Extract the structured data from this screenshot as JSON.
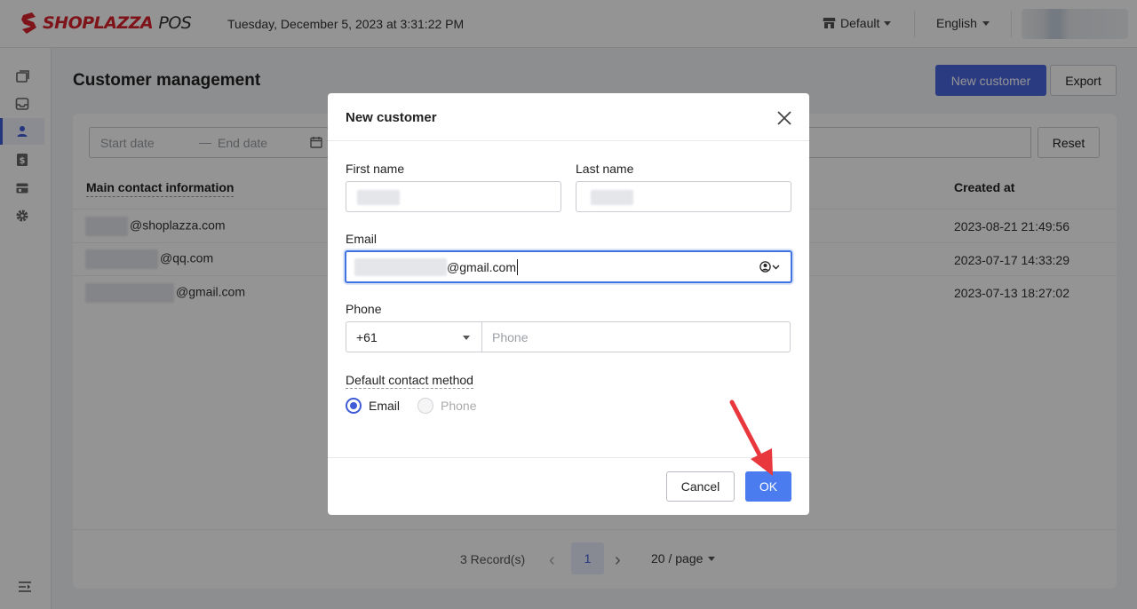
{
  "header": {
    "logo_text": "SHOPLAZZA",
    "logo_suffix": "POS",
    "datetime": "Tuesday, December 5, 2023 at 3:31:22 PM",
    "store": "Default",
    "language": "English"
  },
  "sidebar": {
    "items": [
      {
        "icon": "orders-icon",
        "active": false
      },
      {
        "icon": "inbox-icon",
        "active": false
      },
      {
        "icon": "customer-icon",
        "active": true
      },
      {
        "icon": "dollar-icon",
        "active": false
      },
      {
        "icon": "store-icon",
        "active": false
      },
      {
        "icon": "gear-icon",
        "active": false
      }
    ]
  },
  "page": {
    "title": "Customer management",
    "new_customer_label": "New customer",
    "export_label": "Export",
    "reset_label": "Reset",
    "date_start_placeholder": "Start date",
    "date_end_placeholder": "End date",
    "date_separator": "—"
  },
  "table": {
    "headers": {
      "main_contact": "Main contact information",
      "created_at": "Created at"
    },
    "rows": [
      {
        "email_domain": "@shoplazza.com",
        "created_at": "2023-08-21 21:49:56"
      },
      {
        "email_domain": "@qq.com",
        "created_at": "2023-07-17 14:33:29"
      },
      {
        "email_domain": "@gmail.com",
        "created_at": "2023-07-13 18:27:02"
      }
    ]
  },
  "pagination": {
    "records": "3 Record(s)",
    "prev": "‹",
    "current_page": "1",
    "next": "›",
    "page_size": "20 / page"
  },
  "modal": {
    "title": "New customer",
    "first_name_label": "First name",
    "last_name_label": "Last name",
    "email_label": "Email",
    "email_value_suffix": "@gmail.com",
    "phone_label": "Phone",
    "country_code": "+61",
    "phone_placeholder": "Phone",
    "default_contact_label": "Default contact method",
    "radio_email": "Email",
    "radio_phone": "Phone",
    "cancel_label": "Cancel",
    "ok_label": "OK"
  },
  "colors": {
    "primary": "#4a67e0",
    "ok_button": "#4a7cf0",
    "annotation_arrow": "#e8383d",
    "brand_red": "#d9232e"
  }
}
